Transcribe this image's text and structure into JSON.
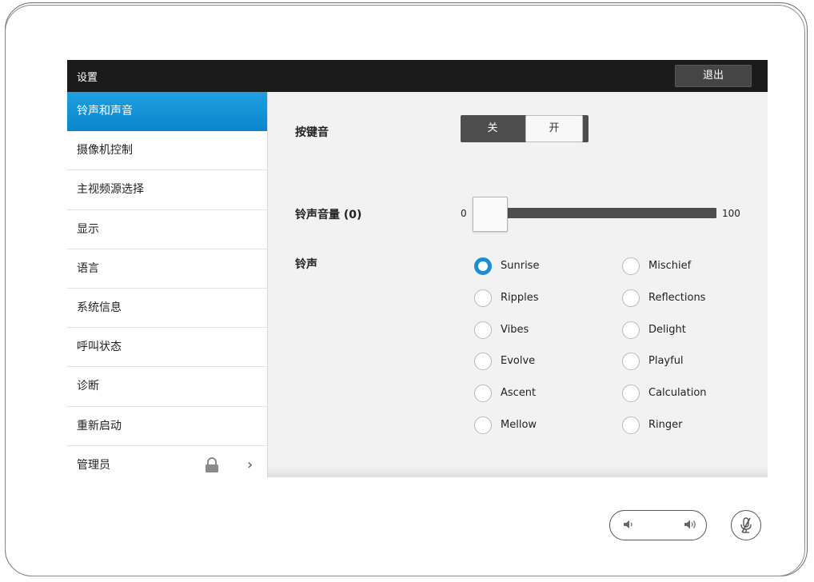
{
  "topbar": {
    "title": "设置",
    "exit_label": "退出"
  },
  "sidebar": {
    "items": [
      {
        "label": "铃声和声音",
        "active": true
      },
      {
        "label": "摄像机控制"
      },
      {
        "label": "主视频源选择"
      },
      {
        "label": "显示"
      },
      {
        "label": "语言"
      },
      {
        "label": "系统信息"
      },
      {
        "label": "呼叫状态"
      },
      {
        "label": "诊断"
      },
      {
        "label": "重新启动"
      },
      {
        "label": "管理员",
        "icons": [
          "lock-icon",
          "chevron-right-icon"
        ]
      }
    ]
  },
  "key_tone": {
    "label": "按键音",
    "off_label": "关",
    "on_label": "开",
    "state": "on"
  },
  "ringtone_volume": {
    "label": "铃声音量 (0)",
    "min": "0",
    "max": "100",
    "value": 0
  },
  "ringtone": {
    "label": "铃声",
    "selected": "Sunrise",
    "options": [
      "Sunrise",
      "Mischief",
      "Ripples",
      "Reflections",
      "Vibes",
      "Delight",
      "Evolve",
      "Playful",
      "Ascent",
      "Calculation",
      "Mellow",
      "Ringer"
    ]
  },
  "controls": {
    "volume_icons": [
      "volume-down-icon",
      "volume-up-icon"
    ],
    "mute_icon": "mic-muted-icon"
  },
  "colors": {
    "accent": "#1a8fd6",
    "topbar": "#1b1b1b"
  }
}
